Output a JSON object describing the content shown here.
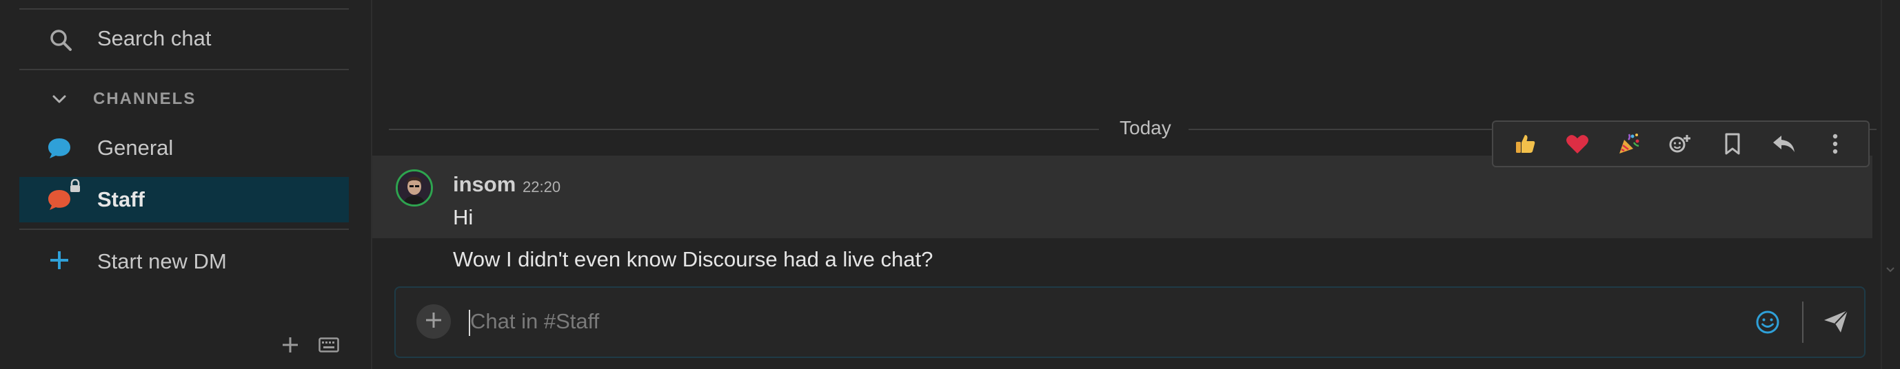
{
  "sidebar": {
    "search_label": "Search chat",
    "channels_heading": "CHANNELS",
    "channels": [
      {
        "label": "General",
        "color": "#2fa0d8",
        "locked": false,
        "active": false
      },
      {
        "label": "Staff",
        "color": "#e45735",
        "locked": true,
        "active": true
      }
    ],
    "new_dm_label": "Start new DM",
    "accent_color": "#2fa0d8"
  },
  "main": {
    "date_separator": "Today",
    "messages": [
      {
        "author": "insom",
        "time": "22:20",
        "text": "Hi",
        "avatar": "avatar"
      },
      {
        "text": "Wow I didn't even know Discourse had a live chat?"
      }
    ],
    "reaction_bar": [
      {
        "icon": "thumbs-up-icon"
      },
      {
        "icon": "heart-icon"
      },
      {
        "icon": "party-popper-icon"
      },
      {
        "icon": "add-reaction-icon"
      },
      {
        "icon": "bookmark-icon"
      },
      {
        "icon": "reply-icon"
      },
      {
        "icon": "more-icon"
      }
    ]
  },
  "composer": {
    "placeholder": "Chat in #Staff",
    "value": ""
  }
}
